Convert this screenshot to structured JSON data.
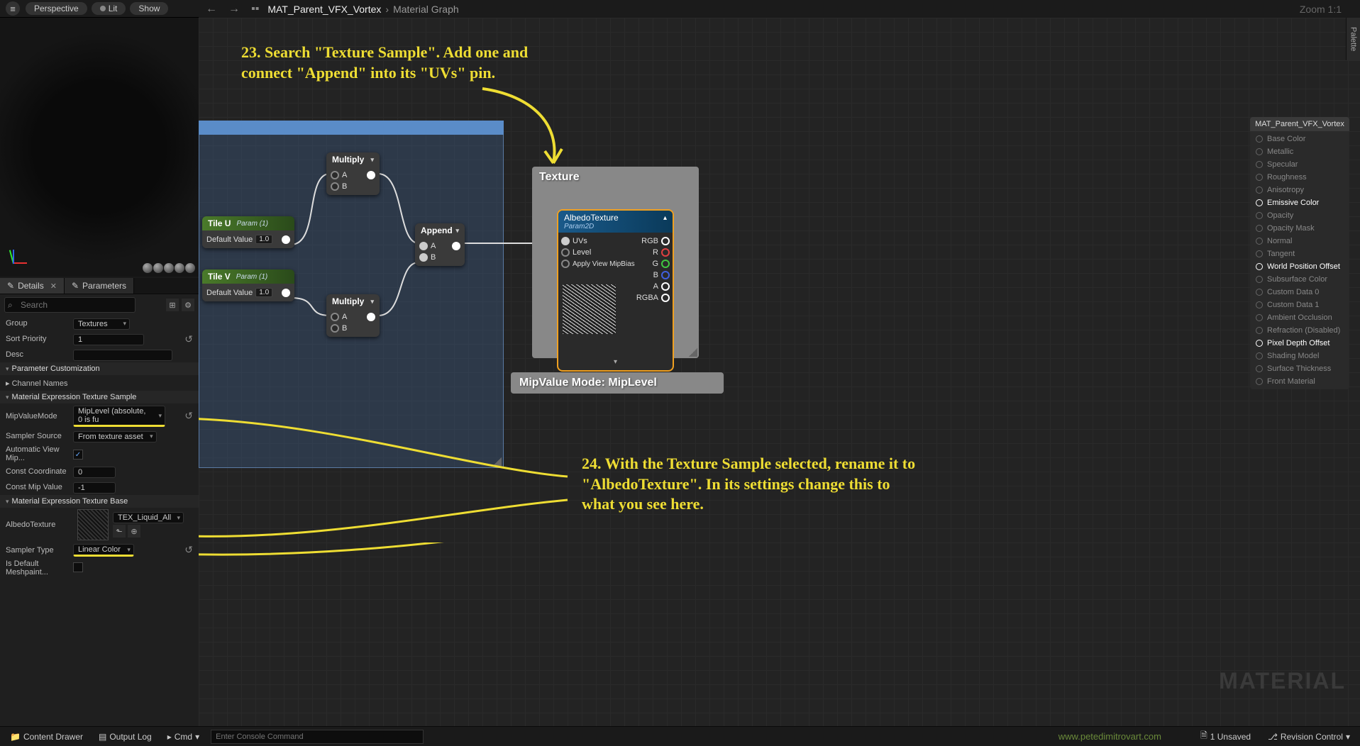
{
  "toolbar": {
    "perspective": "Perspective",
    "lit": "Lit",
    "show": "Show"
  },
  "graph_bar": {
    "breadcrumb_root": "MAT_Parent_VFX_Vortex",
    "breadcrumb_current": "Material Graph",
    "zoom": "Zoom 1:1"
  },
  "palette": "Palette",
  "details": {
    "tab_details": "Details",
    "tab_parameters": "Parameters",
    "search_placeholder": "Search",
    "group_label": "Group",
    "group_value": "Textures",
    "sort_label": "Sort Priority",
    "sort_value": "1",
    "desc_label": "Desc",
    "section_param_custom": "Parameter Customization",
    "channel_names": "Channel Names",
    "section_tex_sample": "Material Expression Texture Sample",
    "mipmode_label": "MipValueMode",
    "mipmode_value": "MipLevel (absolute, 0 is fu",
    "sampler_src_label": "Sampler Source",
    "sampler_src_value": "From texture asset",
    "autoview_label": "Automatic View Mip...",
    "constcoord_label": "Const Coordinate",
    "constcoord_value": "0",
    "constmip_label": "Const Mip Value",
    "constmip_value": "-1",
    "section_tex_base": "Material Expression Texture Base",
    "albedo_label": "AlbedoTexture",
    "albedo_tex_name": "TEX_Liquid_All",
    "sampler_type_label": "Sampler Type",
    "sampler_type_value": "Linear Color",
    "default_mesh_label": "Is Default Meshpaint..."
  },
  "nodes": {
    "tileu": {
      "title": "Tile U",
      "subtitle": "Param (1)",
      "label": "Default Value",
      "value": "1.0"
    },
    "tilev": {
      "title": "Tile V",
      "subtitle": "Param (1)",
      "label": "Default Value",
      "value": "1.0"
    },
    "multiply1": {
      "title": "Multiply",
      "a": "A",
      "b": "B"
    },
    "multiply2": {
      "title": "Multiply",
      "a": "A",
      "b": "B"
    },
    "append": {
      "title": "Append",
      "a": "A",
      "b": "B"
    },
    "texture_comment": "Texture",
    "tex_node": {
      "title": "AlbedoTexture",
      "subtitle": "Param2D",
      "in_uvs": "UVs",
      "in_level": "Level",
      "in_bias": "Apply View MipBias",
      "out_rgb": "RGB",
      "out_r": "R",
      "out_g": "G",
      "out_b": "B",
      "out_a": "A",
      "out_rgba": "RGBA"
    },
    "mip_label": "MipValue Mode: MipLevel"
  },
  "output": {
    "title": "MAT_Parent_VFX_Vortex",
    "pins": [
      "Base Color",
      "Metallic",
      "Specular",
      "Roughness",
      "Anisotropy",
      "Emissive Color",
      "Opacity",
      "Opacity Mask",
      "Normal",
      "Tangent",
      "World Position Offset",
      "Subsurface Color",
      "Custom Data 0",
      "Custom Data 1",
      "Ambient Occlusion",
      "Refraction (Disabled)",
      "Pixel Depth Offset",
      "Shading Model",
      "Surface Thickness",
      "Front Material"
    ]
  },
  "output_active": [
    5,
    10,
    16
  ],
  "annotations": {
    "a23": "23. Search \"Texture Sample\". Add one and connect \"Append\" into its \"UVs\" pin.",
    "a24": "24. With the Texture Sample selected, rename it to \"AlbedoTexture\". In its settings change this to what you see here."
  },
  "bottom": {
    "content_drawer": "Content Drawer",
    "output_log": "Output Log",
    "cmd": "Cmd",
    "console_placeholder": "Enter Console Command",
    "unsaved": "1 Unsaved",
    "revision": "Revision Control"
  },
  "watermark": "MATERIAL",
  "credit": "www.petedimitrovart.com"
}
